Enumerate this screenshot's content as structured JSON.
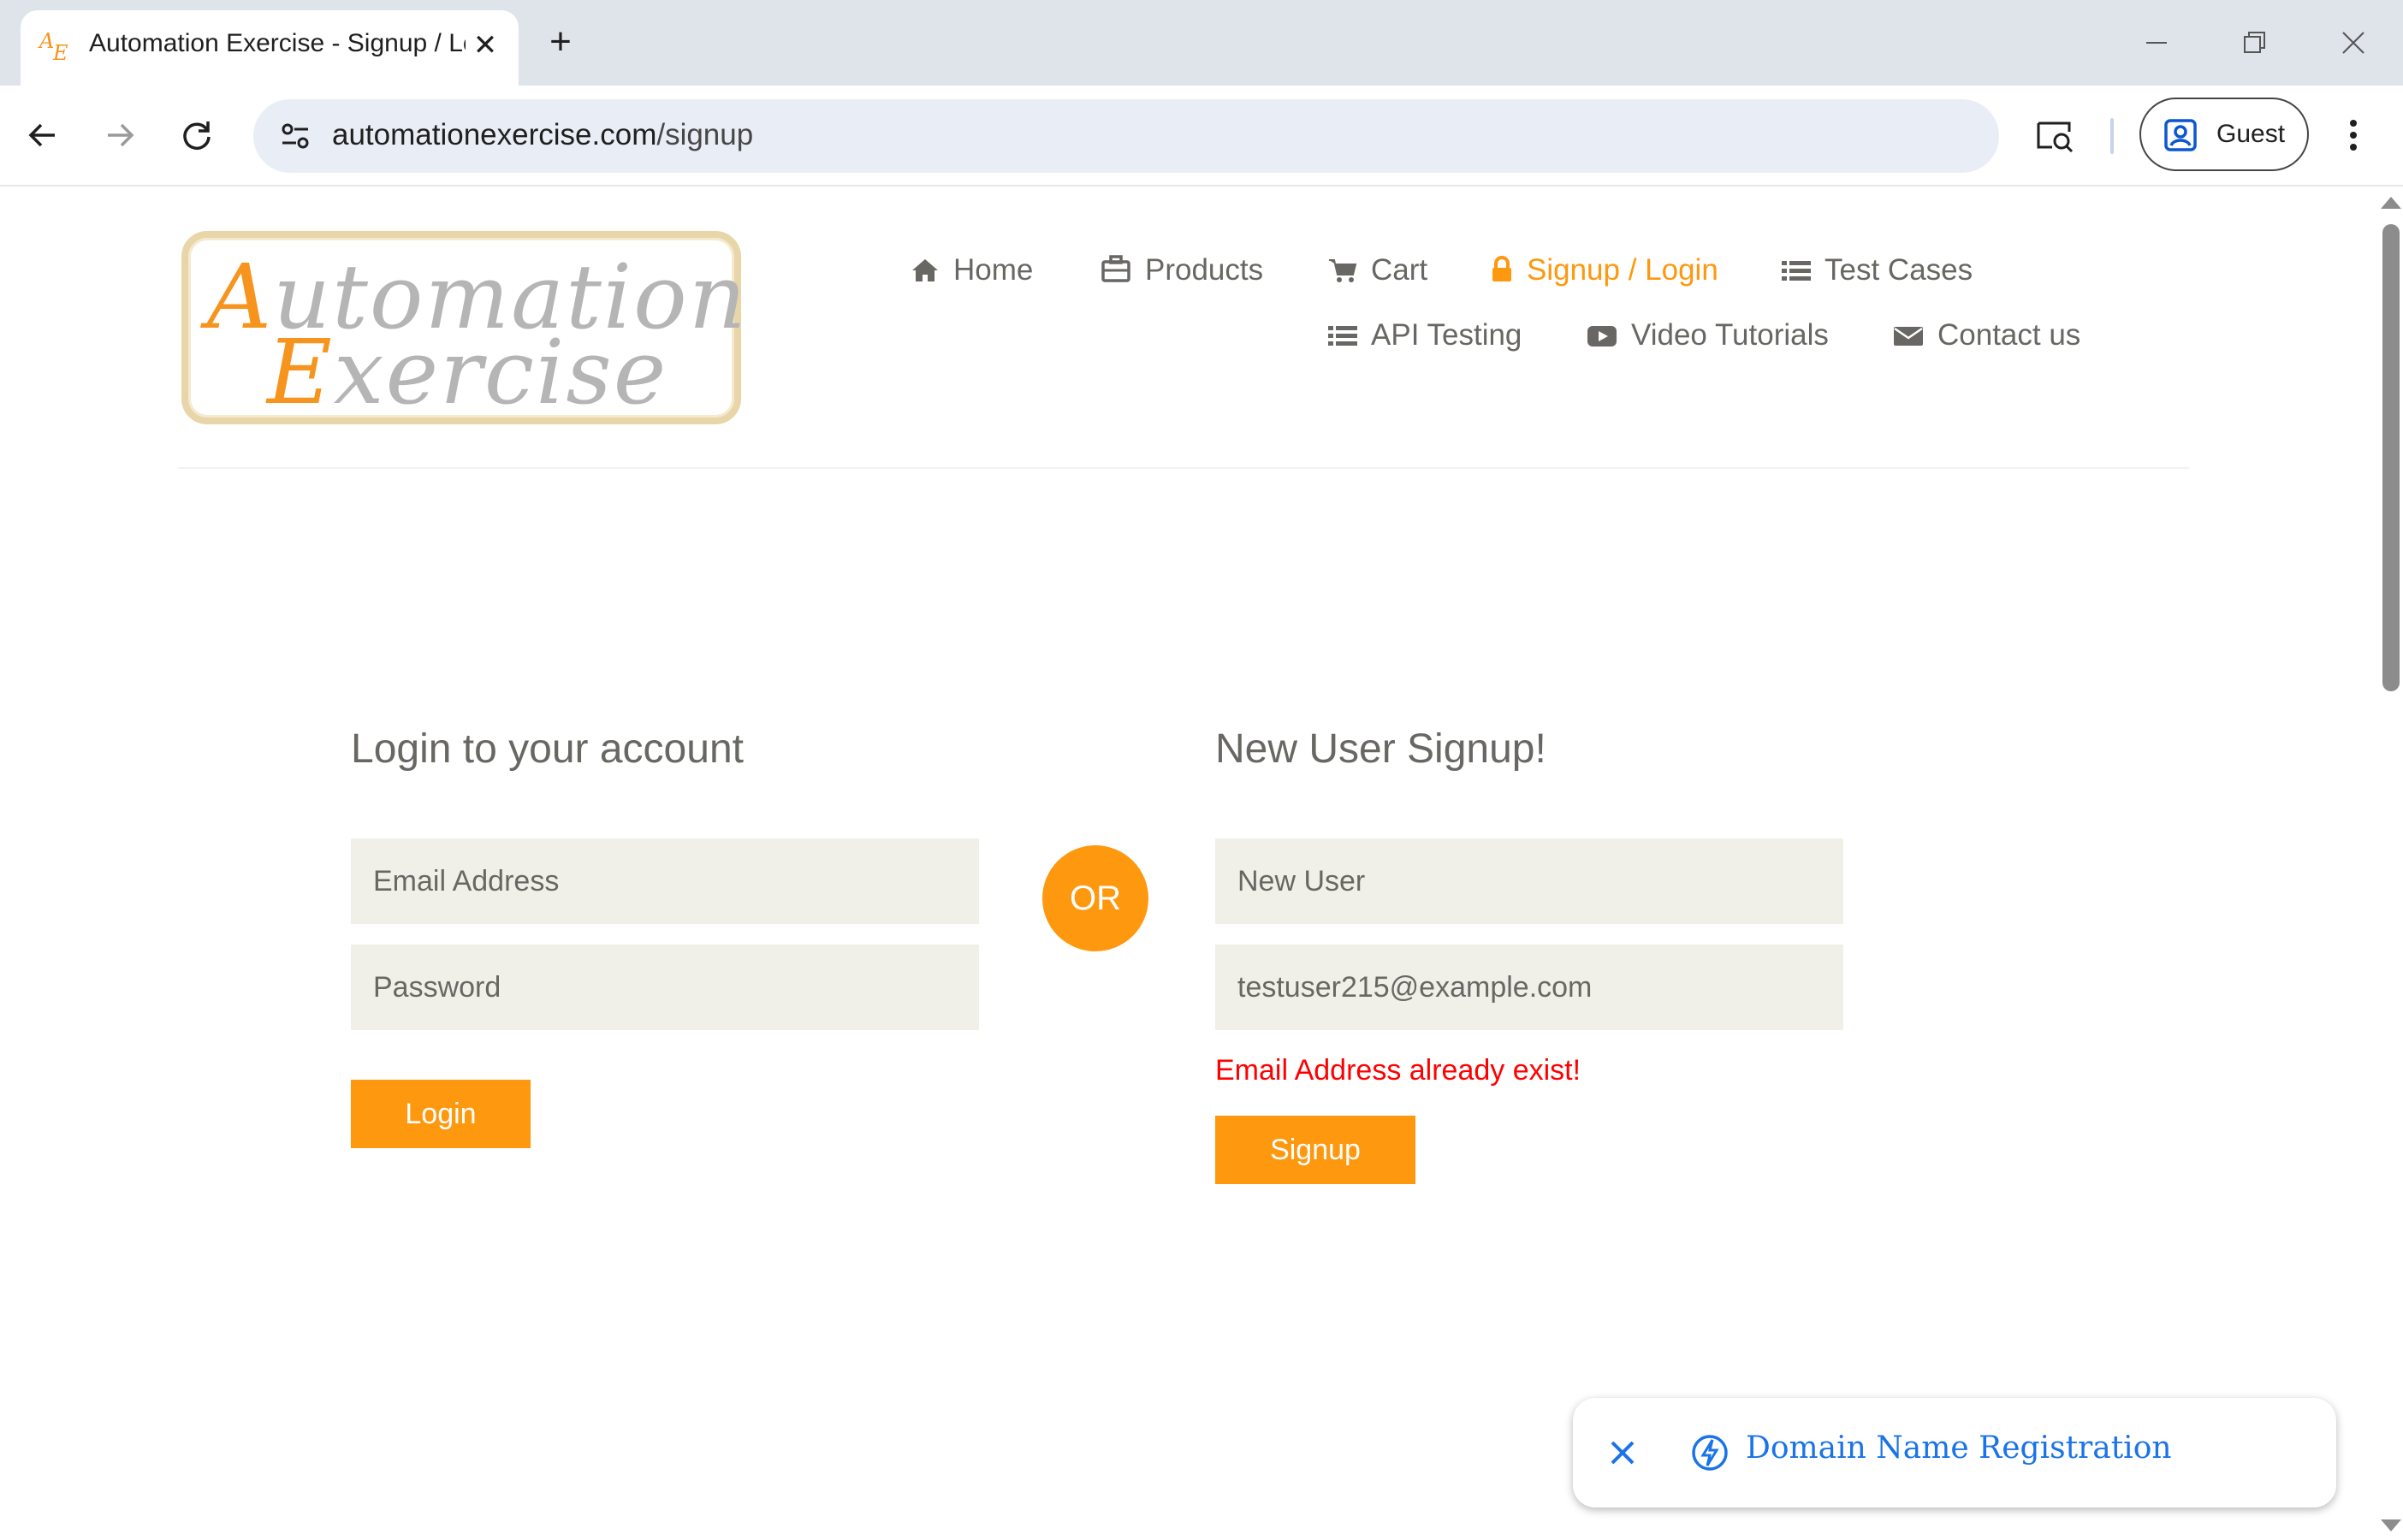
{
  "browser": {
    "tab_title": "Automation Exercise - Signup / Login",
    "favicon_text_top": "A",
    "favicon_text_bottom": "E",
    "url_host": "automationexercise.com",
    "url_path": "/signup",
    "profile_label": "Guest"
  },
  "header": {
    "logo_line1_cap": "A",
    "logo_line1_rest": "utomation",
    "logo_line2_cap": "E",
    "logo_line2_rest": "xercise",
    "nav": [
      {
        "label": "Home",
        "icon": "home-icon"
      },
      {
        "label": "Products",
        "icon": "briefcase-icon"
      },
      {
        "label": "Cart",
        "icon": "cart-icon"
      },
      {
        "label": "Signup / Login",
        "icon": "lock-icon",
        "active": true
      },
      {
        "label": "Test Cases",
        "icon": "list-icon"
      },
      {
        "label": "API Testing",
        "icon": "list-icon"
      },
      {
        "label": "Video Tutorials",
        "icon": "youtube-play-icon"
      },
      {
        "label": "Contact us",
        "icon": "envelope-icon"
      }
    ]
  },
  "login": {
    "heading": "Login to your account",
    "email_placeholder": "Email Address",
    "password_placeholder": "Password",
    "button": "Login"
  },
  "or_label": "OR",
  "signup": {
    "heading": "New User Signup!",
    "name_value": "New User",
    "email_value": "testuser215@example.com",
    "error": "Email Address already exist!",
    "button": "Signup"
  },
  "ad": {
    "label": "Domain Name Registration"
  },
  "colors": {
    "accent": "#fe980f",
    "text": "#696763",
    "error": "#ff0000",
    "link": "#1a73e8"
  }
}
